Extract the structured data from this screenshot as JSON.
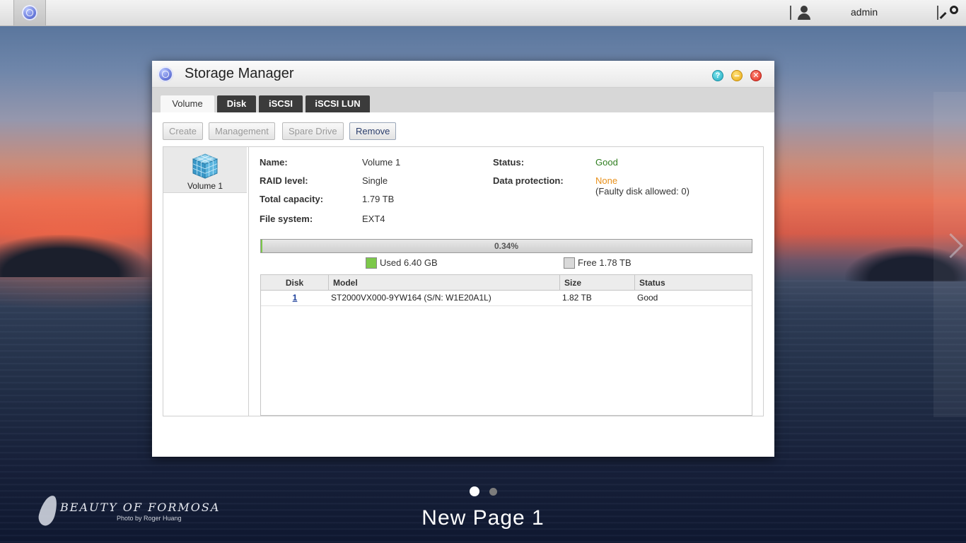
{
  "topbar": {
    "username": "admin"
  },
  "window": {
    "title": "Storage Manager",
    "help_glyph": "?",
    "tabs": [
      {
        "label": "Volume"
      },
      {
        "label": "Disk"
      },
      {
        "label": "iSCSI"
      },
      {
        "label": "iSCSI LUN"
      }
    ],
    "active_tab": "Volume",
    "toolbar": {
      "create": "Create",
      "management": "Management",
      "spare_drive": "Spare Drive",
      "remove": "Remove"
    },
    "volumes": [
      {
        "label": "Volume 1"
      }
    ],
    "details": {
      "name_label": "Name:",
      "name_value": "Volume 1",
      "raid_label": "RAID level:",
      "raid_value": "Single",
      "capacity_label": "Total capacity:",
      "capacity_value": "1.79 TB",
      "fs_label": "File system:",
      "fs_value": "EXT4",
      "status_label": "Status:",
      "status_value": "Good",
      "protection_label": "Data protection:",
      "protection_value": "None",
      "protection_note": "(Faulty disk allowed: 0)"
    },
    "usage": {
      "percent_text": "0.34%",
      "percent": 0.34,
      "used_label": "Used 6.40 GB",
      "free_label": "Free 1.78 TB"
    },
    "disk_table": {
      "headers": [
        "Disk",
        "Model",
        "Size",
        "Status"
      ],
      "rows": [
        {
          "disk": "1",
          "model": "ST2000VX000-9YW164 (S/N: W1E20A1L)",
          "size": "1.82 TB",
          "status": "Good"
        }
      ]
    }
  },
  "desktop": {
    "page_name": "New Page 1",
    "watermark_title": "BEAUTY OF FORMOSA",
    "watermark_credit": "Photo by Roger Huang"
  },
  "colors": {
    "status_good": "#2e7d1e",
    "protection_none": "#e8901a",
    "used": "#7cc84a",
    "free": "#d9d9d9"
  },
  "icons": {
    "app": "storage-manager-icon",
    "user": "user-icon",
    "search": "search-icon",
    "volume": "cube-icon"
  }
}
